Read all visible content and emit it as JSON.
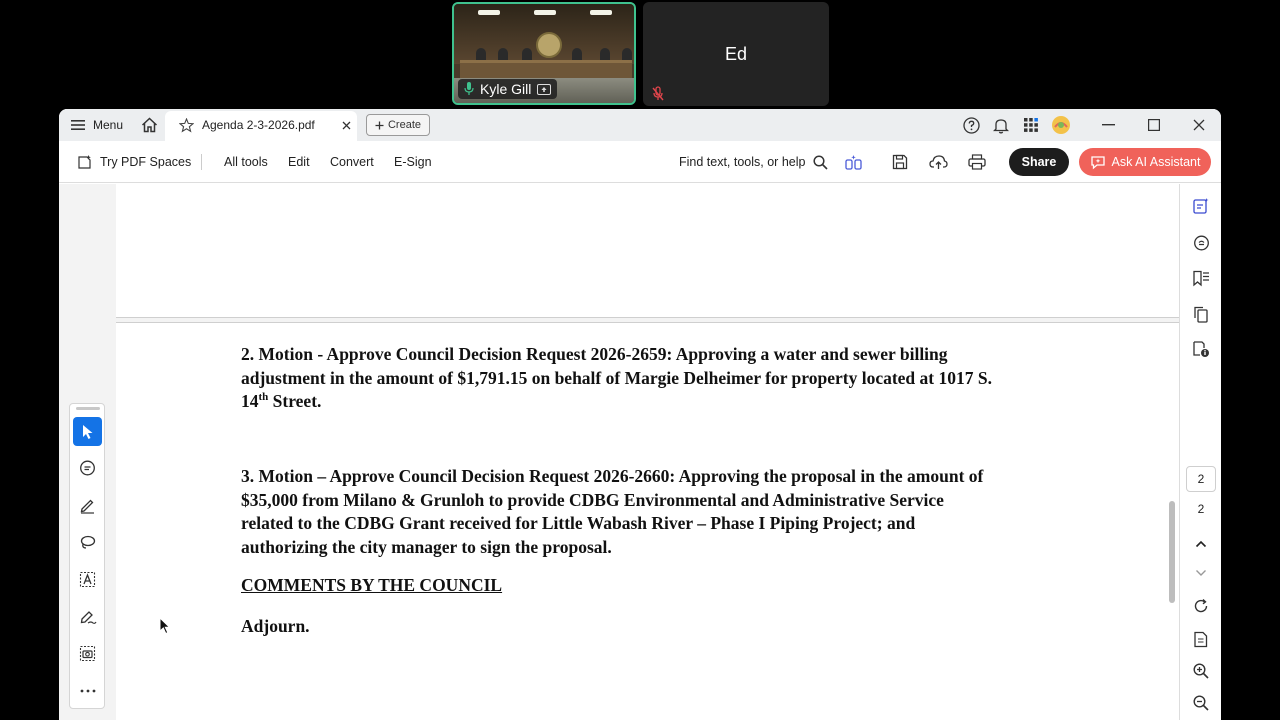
{
  "meeting": {
    "tile1_name": "Kyle Gill",
    "tile2_name": "Ed"
  },
  "titlebar": {
    "menu_label": "Menu",
    "tab_title": "Agenda 2-3-2026.pdf",
    "create_label": "Create"
  },
  "toolbar": {
    "pdf_spaces": "Try PDF Spaces",
    "all_tools": "All tools",
    "edit": "Edit",
    "convert": "Convert",
    "esign": "E-Sign",
    "find": "Find text, tools, or help",
    "share": "Share",
    "ai": "Ask AI Assistant"
  },
  "document": {
    "item2_line1": "2. Motion - Approve Council Decision Request 2026-2659: Approving a water and sewer billing",
    "item2_line2": "adjustment in the amount of $1,791.15 on behalf of Margie Delheimer for property located at 1017 S.",
    "item2_line3_pre": "14",
    "item2_line3_sup": "th",
    "item2_line3_post": " Street.",
    "item3_line1": "3. Motion – Approve Council Decision Request 2026-2660: Approving the proposal in the amount of",
    "item3_line2": "$35,000 from Milano & Grunloh to provide CDBG Environmental and Administrative Service",
    "item3_line3": "related to the CDBG Grant received for Little Wabash River – Phase I Piping Project; and",
    "item3_line4": "authorizing the city manager to sign the proposal.",
    "comments_heading": "COMMENTS BY THE COUNCIL",
    "adjourn": "Adjourn."
  },
  "pagination": {
    "current_page": "2",
    "total_pages": "2"
  },
  "colors": {
    "accent": "#1473e6",
    "share_bg": "#1d1d1d",
    "ai_bg": "#f0625a",
    "speaker_border": "#3fc28e"
  }
}
